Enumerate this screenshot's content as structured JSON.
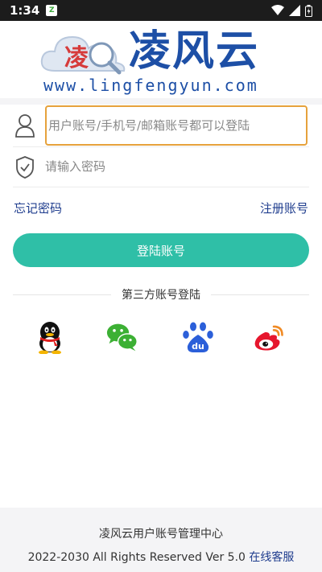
{
  "status_bar": {
    "time": "1:34",
    "app_badge": "Z"
  },
  "logo": {
    "title": "凌风云",
    "url": "www.lingfengyun.com",
    "emblem_char": "凌"
  },
  "login": {
    "account_placeholder": "用户账号/手机号/邮箱账号都可以登陆",
    "password_placeholder": "请输入密码",
    "forgot_link": "忘记密码",
    "register_link": "注册账号",
    "login_button": "登陆账号"
  },
  "third_party": {
    "label": "第三方账号登陆",
    "providers": [
      "qq-icon",
      "wechat-icon",
      "baidu-icon",
      "weibo-icon"
    ]
  },
  "footer": {
    "line1": "凌风云用户账号管理中心",
    "copyright": "2022-2030 All Rights Reserved Ver 5.0",
    "service_link": "在线客服"
  },
  "colors": {
    "accent": "#2fbfa7",
    "brand_blue": "#1d4fa6",
    "link": "#1f3d8e",
    "focus_border": "#e6a23c"
  }
}
